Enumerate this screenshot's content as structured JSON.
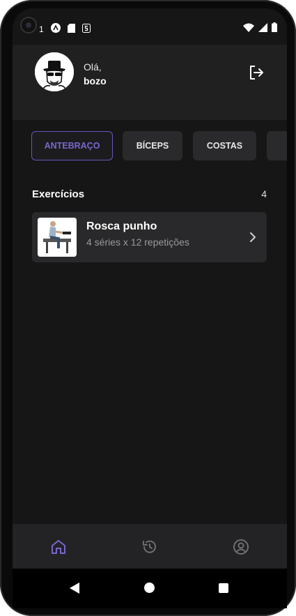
{
  "status_bar": {
    "notification_count": "1",
    "icons_left": [
      "notification-a-icon",
      "sd-card-icon",
      "s-app-icon"
    ],
    "icons_right": [
      "wifi-icon",
      "signal-icon",
      "battery-icon"
    ]
  },
  "header": {
    "greeting": "Olá,",
    "username": "bozo",
    "avatar_icon": "avatar-heisenberg",
    "logout_icon": "logout-icon"
  },
  "groups": [
    {
      "label": "ANTEBRAÇO",
      "active": true
    },
    {
      "label": "BÍCEPS",
      "active": false
    },
    {
      "label": "COSTAS",
      "active": false
    },
    {
      "label": "",
      "active": false
    }
  ],
  "exercises": {
    "title": "Exercícios",
    "count": "4",
    "items": [
      {
        "name": "Rosca punho",
        "details": "4 séries x 12 repetições"
      }
    ]
  },
  "bottom_nav": {
    "items": [
      "home-icon",
      "history-icon",
      "profile-icon"
    ],
    "active": "home-icon"
  },
  "colors": {
    "accent": "#7b66cc",
    "background": "#161616",
    "header": "#202020",
    "card": "#29292b",
    "nav": "#232325"
  }
}
